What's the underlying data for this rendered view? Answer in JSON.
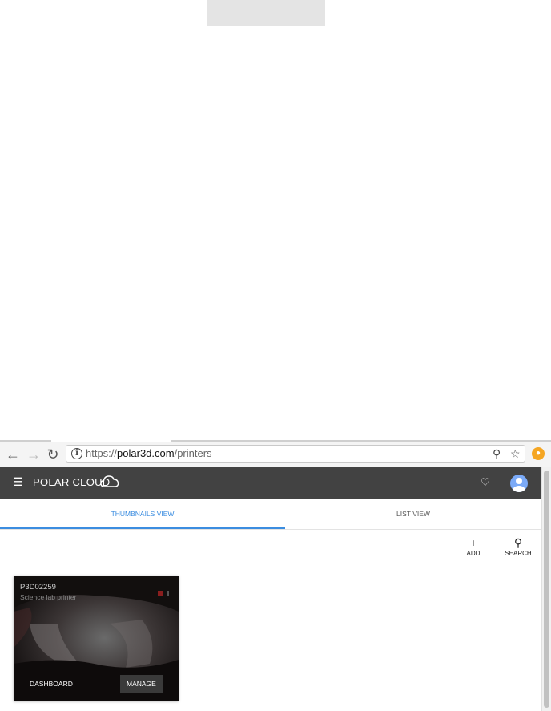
{
  "browser": {
    "url_scheme": "https://",
    "url_domain": "polar3d.com",
    "url_path": "/printers"
  },
  "app": {
    "brand": "POLAR CLOUD",
    "tabs": [
      {
        "label": "THUMBNAILS VIEW",
        "active": true
      },
      {
        "label": "LIST VIEW",
        "active": false
      }
    ],
    "actions": {
      "add_label": "ADD",
      "search_label": "SEARCH"
    },
    "printer_card": {
      "title": "P3D02259",
      "subtitle": "Science lab printer",
      "dashboard_label": "DASHBOARD",
      "manage_label": "MANAGE"
    }
  },
  "colors": {
    "appbar": "#424242",
    "accent": "#3b8de0",
    "extension": "#f5a623"
  },
  "icons": [
    "back-icon",
    "forward-icon",
    "reload-icon",
    "info-icon",
    "zoom-icon",
    "star-icon",
    "extension-icon",
    "menu-icon",
    "cloud-logo-icon",
    "bell-icon",
    "avatar",
    "plus-icon",
    "search-icon"
  ]
}
